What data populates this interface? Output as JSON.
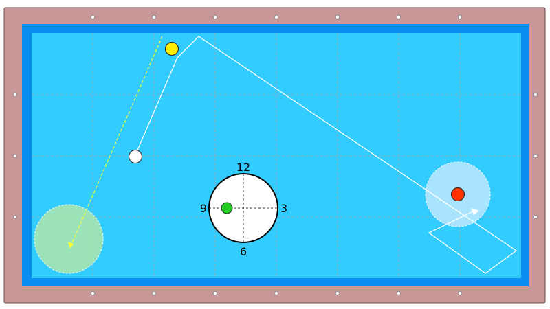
{
  "colors": {
    "rail": "#c89898",
    "cushion": "#0a8ff0",
    "cloth": "#33ccff",
    "grid": "#8fa6b8",
    "diamond": "#ffffff",
    "cue_ball": "#ffffff",
    "object_ball_yellow": "#ffee00",
    "object_ball_red": "#ff3300",
    "spin_dot": "#22cc22",
    "target_zone_green": "#a8e6b0",
    "target_zone_blue": "#b0e6ff",
    "shot_path": "#ffffff",
    "aim_line": "#ffff33"
  },
  "balls": [
    {
      "id": "cue-ball",
      "color": "white"
    },
    {
      "id": "object-ball-yellow",
      "color": "yellow"
    },
    {
      "id": "object-ball-red",
      "color": "red"
    }
  ],
  "spin_indicator": {
    "labels": {
      "top": "12",
      "right": "3",
      "bottom": "6",
      "left": "9"
    },
    "spin_dot_color": "green"
  },
  "target_zones": [
    {
      "id": "green-zone",
      "color": "green"
    },
    {
      "id": "blue-zone",
      "color": "light-blue"
    }
  ],
  "icons": {
    "ball": "circle",
    "arrow": "arrowhead",
    "diamond": "rail-sight-dot"
  }
}
